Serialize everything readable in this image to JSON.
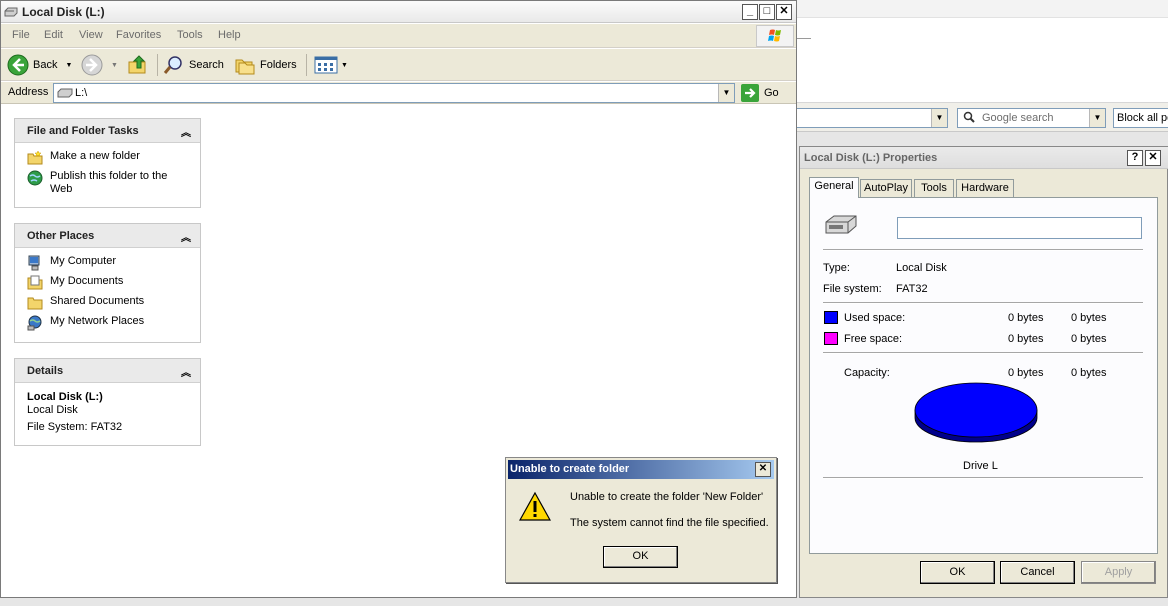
{
  "explorer": {
    "title": "Local Disk (L:)",
    "menu": [
      "File",
      "Edit",
      "View",
      "Favorites",
      "Tools",
      "Help"
    ],
    "toolbar": {
      "back": "Back",
      "search": "Search",
      "folders": "Folders"
    },
    "address": {
      "label": "Address",
      "value": "L:\\",
      "go": "Go"
    },
    "tasks": {
      "title": "File and Folder Tasks",
      "items": [
        "Make a new folder",
        "Publish this folder to the Web"
      ]
    },
    "places": {
      "title": "Other Places",
      "items": [
        "My Computer",
        "My Documents",
        "Shared Documents",
        "My Network Places"
      ]
    },
    "details": {
      "title": "Details",
      "name": "Local Disk (L:)",
      "type": "Local Disk",
      "fs": "File System: FAT32"
    }
  },
  "error_dialog": {
    "title": "Unable to create folder",
    "message1": "Unable to create the folder 'New Folder'",
    "message2": "The system cannot find the file specified.",
    "ok": "OK"
  },
  "browser_bg": {
    "search_placeholder": "Google search",
    "block_text": "Block all po"
  },
  "properties": {
    "title": "Local Disk (L:) Properties",
    "help_btn": "?",
    "tabs": [
      "General",
      "AutoPlay",
      "Tools",
      "Hardware"
    ],
    "type_label": "Type:",
    "type_value": "Local Disk",
    "fs_label": "File system:",
    "fs_value": "FAT32",
    "used_label": "Used space:",
    "used_bytes": "0 bytes",
    "used_size": "0 bytes",
    "free_label": "Free space:",
    "free_bytes": "0 bytes",
    "free_size": "0 bytes",
    "capacity_label": "Capacity:",
    "capacity_bytes": "0 bytes",
    "capacity_size": "0 bytes",
    "drive_label": "Drive L",
    "used_color": "#0000ff",
    "free_color": "#ff00ff",
    "buttons": {
      "ok": "OK",
      "cancel": "Cancel",
      "apply": "Apply"
    }
  }
}
